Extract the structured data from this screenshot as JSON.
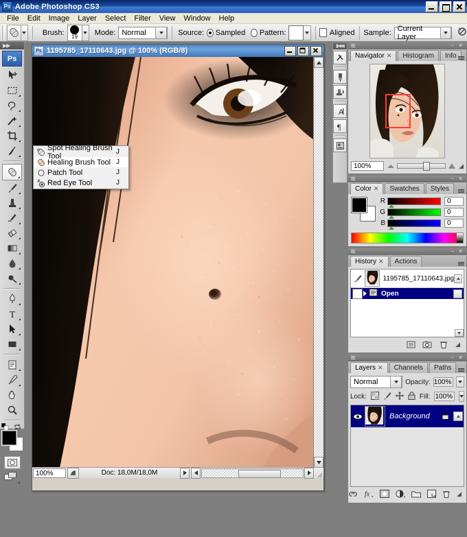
{
  "app": {
    "title": "Adobe Photoshop CS3",
    "logo_text": "Ps",
    "window_buttons": {
      "minimize": "minimize-button",
      "maximize": "maximize-button",
      "close": "close-button"
    }
  },
  "menubar": {
    "items": [
      {
        "label": "File"
      },
      {
        "label": "Edit"
      },
      {
        "label": "Image"
      },
      {
        "label": "Layer"
      },
      {
        "label": "Select"
      },
      {
        "label": "Filter"
      },
      {
        "label": "View"
      },
      {
        "label": "Window"
      },
      {
        "label": "Help"
      }
    ]
  },
  "options_bar": {
    "brush_label": "Brush:",
    "brush_size": "19",
    "mode_label": "Mode:",
    "mode_value": "Normal",
    "source_label": "Source:",
    "source_sampled": "Sampled",
    "source_pattern": "Pattern:",
    "aligned_label": "Aligned",
    "sample_label": "Sample:",
    "sample_value": "Current Layer"
  },
  "toolbox": {
    "logo": "Ps",
    "tools": [
      {
        "name": "move-tool"
      },
      {
        "name": "rectangular-marquee-tool"
      },
      {
        "name": "lasso-tool"
      },
      {
        "name": "magic-wand-tool"
      },
      {
        "name": "crop-tool"
      },
      {
        "name": "slice-tool"
      },
      {
        "name": "healing-brush-tool",
        "selected": true
      },
      {
        "name": "brush-tool"
      },
      {
        "name": "clone-stamp-tool"
      },
      {
        "name": "history-brush-tool"
      },
      {
        "name": "eraser-tool"
      },
      {
        "name": "gradient-tool"
      },
      {
        "name": "blur-tool"
      },
      {
        "name": "dodge-tool"
      },
      {
        "name": "pen-tool"
      },
      {
        "name": "type-tool"
      },
      {
        "name": "path-selection-tool"
      },
      {
        "name": "rectangle-tool"
      },
      {
        "name": "notes-tool"
      },
      {
        "name": "eyedropper-tool"
      },
      {
        "name": "hand-tool"
      },
      {
        "name": "zoom-tool"
      }
    ],
    "foreground_color": "#000000",
    "background_color": "#ffffff"
  },
  "tool_flyout": {
    "items": [
      {
        "label": "Spot Healing Brush Tool",
        "shortcut": "J",
        "icon": "spot-healing-brush-icon",
        "highlighted": false
      },
      {
        "label": "Healing Brush Tool",
        "shortcut": "J",
        "icon": "healing-brush-icon",
        "highlighted": true
      },
      {
        "label": "Patch Tool",
        "shortcut": "J",
        "icon": "patch-icon",
        "highlighted": false
      },
      {
        "label": "Red Eye Tool",
        "shortcut": "J",
        "icon": "red-eye-icon",
        "highlighted": false
      }
    ]
  },
  "document": {
    "title": "1195785_17110643.jpg @ 100% (RGB/8)",
    "zoom": "100%",
    "doc_size": "Doc: 18,0M/18,0M"
  },
  "dock_strip": {
    "items": [
      {
        "name": "tool-presets-icon"
      },
      {
        "name": "brushes-icon"
      },
      {
        "name": "clone-source-icon"
      },
      {
        "name": "character-icon"
      },
      {
        "name": "paragraph-icon"
      },
      {
        "name": "layer-comps-icon"
      }
    ]
  },
  "navigator_panel": {
    "tabs": [
      {
        "label": "Navigator",
        "active": true,
        "closable": true
      },
      {
        "label": "Histogram",
        "active": false,
        "closable": false
      },
      {
        "label": "Info",
        "active": false,
        "closable": false
      }
    ],
    "zoom": "100%",
    "view_rect_color": "#ff3b30"
  },
  "color_panel": {
    "tabs": [
      {
        "label": "Color",
        "active": true,
        "closable": true
      },
      {
        "label": "Swatches",
        "active": false,
        "closable": false
      },
      {
        "label": "Styles",
        "active": false,
        "closable": false
      }
    ],
    "channels": [
      {
        "label": "R",
        "value": "0"
      },
      {
        "label": "G",
        "value": "0"
      },
      {
        "label": "B",
        "value": "0"
      }
    ],
    "foreground": "#000000",
    "background": "#ffffff"
  },
  "history_panel": {
    "tabs": [
      {
        "label": "History",
        "active": true,
        "closable": true
      },
      {
        "label": "Actions",
        "active": false,
        "closable": false
      }
    ],
    "snapshot": "1195785_17110643.jpg",
    "states": [
      {
        "label": "Open",
        "selected": true
      }
    ],
    "footer_icons": [
      {
        "name": "create-document-from-state-icon"
      },
      {
        "name": "create-new-snapshot-icon"
      },
      {
        "name": "delete-state-icon"
      }
    ]
  },
  "layers_panel": {
    "tabs": [
      {
        "label": "Layers",
        "active": true,
        "closable": true
      },
      {
        "label": "Channels",
        "active": false,
        "closable": false
      },
      {
        "label": "Paths",
        "active": false,
        "closable": false
      }
    ],
    "blend_mode": "Normal",
    "opacity_label": "Opacity:",
    "opacity_value": "100%",
    "lock_label": "Lock:",
    "fill_label": "Fill:",
    "fill_value": "100%",
    "lock_icons": [
      {
        "name": "lock-transparent-pixels-icon"
      },
      {
        "name": "lock-image-pixels-icon"
      },
      {
        "name": "lock-position-icon"
      },
      {
        "name": "lock-all-icon"
      }
    ],
    "layers": [
      {
        "name": "Background",
        "visible": true,
        "locked": true,
        "selected": true
      }
    ],
    "footer_icons": [
      {
        "name": "link-layers-icon"
      },
      {
        "name": "layer-style-icon"
      },
      {
        "name": "layer-mask-icon"
      },
      {
        "name": "adjustment-layer-icon"
      },
      {
        "name": "new-group-icon"
      },
      {
        "name": "new-layer-icon"
      },
      {
        "name": "delete-layer-icon"
      }
    ]
  }
}
